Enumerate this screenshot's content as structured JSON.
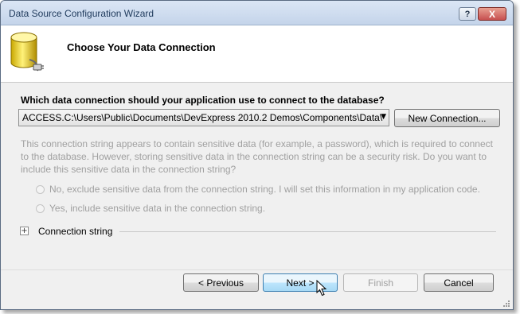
{
  "window": {
    "title": "Data Source Configuration Wizard",
    "help_label": "?",
    "close_label": "X"
  },
  "header": {
    "title": "Choose Your Data Connection",
    "icon": "database-plug-icon"
  },
  "connection": {
    "question": "Which data connection should your application use to connect to the database?",
    "selected": "ACCESS.C:\\Users\\Public\\Documents\\DevExpress 2010.2 Demos\\Components\\Data\\",
    "new_connection_label": "New Connection..."
  },
  "sensitive": {
    "description": "This connection string appears to contain sensitive data (for example, a password), which is required to connect to the database. However, storing sensitive data in the connection string can be a security risk. Do you want to include this sensitive data in the connection string?",
    "option_no": "No, exclude sensitive data from the connection string. I will set this information in my application code.",
    "option_yes": "Yes, include sensitive data in the connection string."
  },
  "expander": {
    "symbol": "+",
    "label": "Connection string"
  },
  "footer": {
    "previous": "< Previous",
    "next": "Next >",
    "finish": "Finish",
    "cancel": "Cancel"
  }
}
